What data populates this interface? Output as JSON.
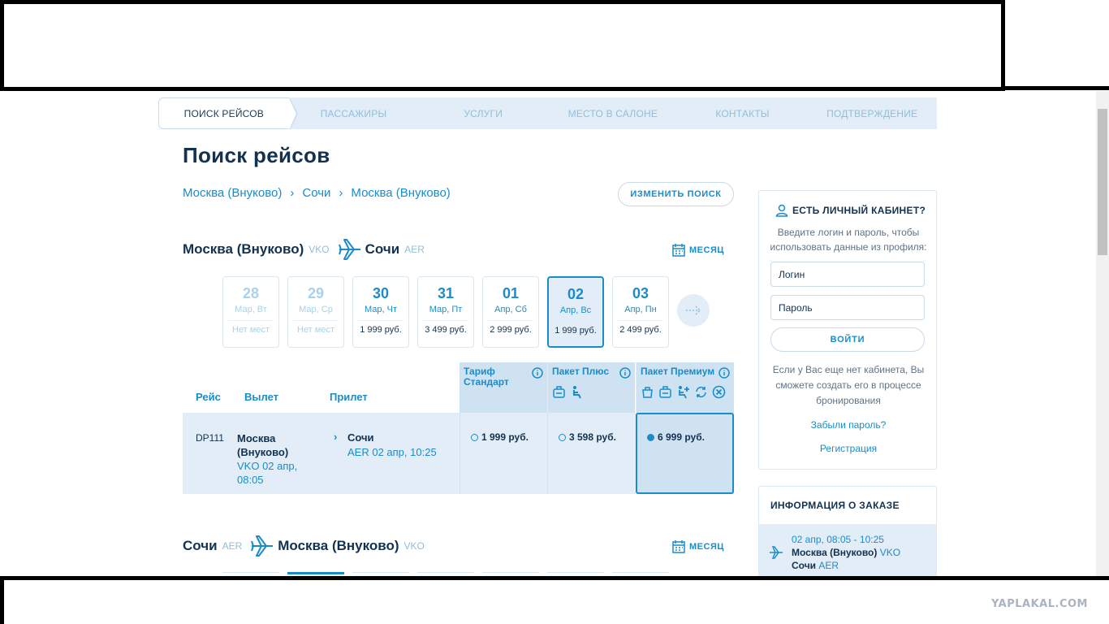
{
  "steps": [
    "ПОИСК РЕЙСОВ",
    "ПАССАЖИРЫ",
    "УСЛУГИ",
    "МЕСТО В САЛОНЕ",
    "КОНТАКТЫ",
    "ПОДТВЕРЖДЕНИЕ"
  ],
  "page_title": "Поиск рейсов",
  "route": {
    "from": "Москва (Внуково)",
    "via": "Сочи",
    "to": "Москва (Внуково)",
    "sep": "›"
  },
  "change_search": "ИЗМЕНИТЬ ПОИСК",
  "leg1": {
    "from": "Москва (Внуково)",
    "from_code": "VKO",
    "to": "Сочи",
    "to_code": "AER",
    "month": "МЕСЯЦ"
  },
  "leg2": {
    "from": "Сочи",
    "from_code": "AER",
    "to": "Москва (Внуково)",
    "to_code": "VKO",
    "month": "МЕСЯЦ"
  },
  "dates": [
    {
      "num": "28",
      "day": "Мар, Вт",
      "price": "Нет мест"
    },
    {
      "num": "29",
      "day": "Мар, Ср",
      "price": "Нет мест"
    },
    {
      "num": "30",
      "day": "Мар, Чт",
      "price": "1 999 руб."
    },
    {
      "num": "31",
      "day": "Мар, Пт",
      "price": "3 499 руб."
    },
    {
      "num": "01",
      "day": "Апр, Сб",
      "price": "2 999 руб."
    },
    {
      "num": "02",
      "day": "Апр, Вс",
      "price": "1 999 руб."
    },
    {
      "num": "03",
      "day": "Апр, Пн",
      "price": "2 499 руб."
    }
  ],
  "table": {
    "col_flight": "Рейс",
    "col_depart": "Вылет",
    "col_arrive": "Прилет",
    "tariffs": [
      "Тариф Стандарт",
      "Пакет Плюс",
      "Пакет Премиум"
    ]
  },
  "flight": {
    "number": "DP111",
    "from": "Москва (Внуково)",
    "from_detail": "VKO 02 апр, 08:05",
    "to": "Сочи",
    "to_detail": "AER 02 апр, 10:25",
    "prices": [
      "1 999 руб.",
      "3 598 руб.",
      "6 999 руб."
    ]
  },
  "login": {
    "title": "ЕСТЬ ЛИЧНЫЙ КАБИНЕТ?",
    "desc": "Введите логин и пароль, чтобы использовать данные из профиля:",
    "login_placeholder": "Логин",
    "password_placeholder": "Пароль",
    "button": "ВОЙТИ",
    "note": "Если у Вас еще нет кабинета, Вы сможете создать его в процессе бронирования",
    "forgot": "Забыли пароль?",
    "register": "Регистрация"
  },
  "order": {
    "title": "ИНФОРМАЦИЯ О ЗАКАЗЕ",
    "time": "02 апр, 08:05 - 10:25",
    "from": "Москва (Внуково)",
    "from_code": "VKO",
    "to": "Сочи",
    "to_code": "AER"
  },
  "watermark": "YAPLAKAL.COM",
  "colors": {
    "accent": "#1a8cc9",
    "dark": "#13324f",
    "light": "#e2edf7"
  }
}
